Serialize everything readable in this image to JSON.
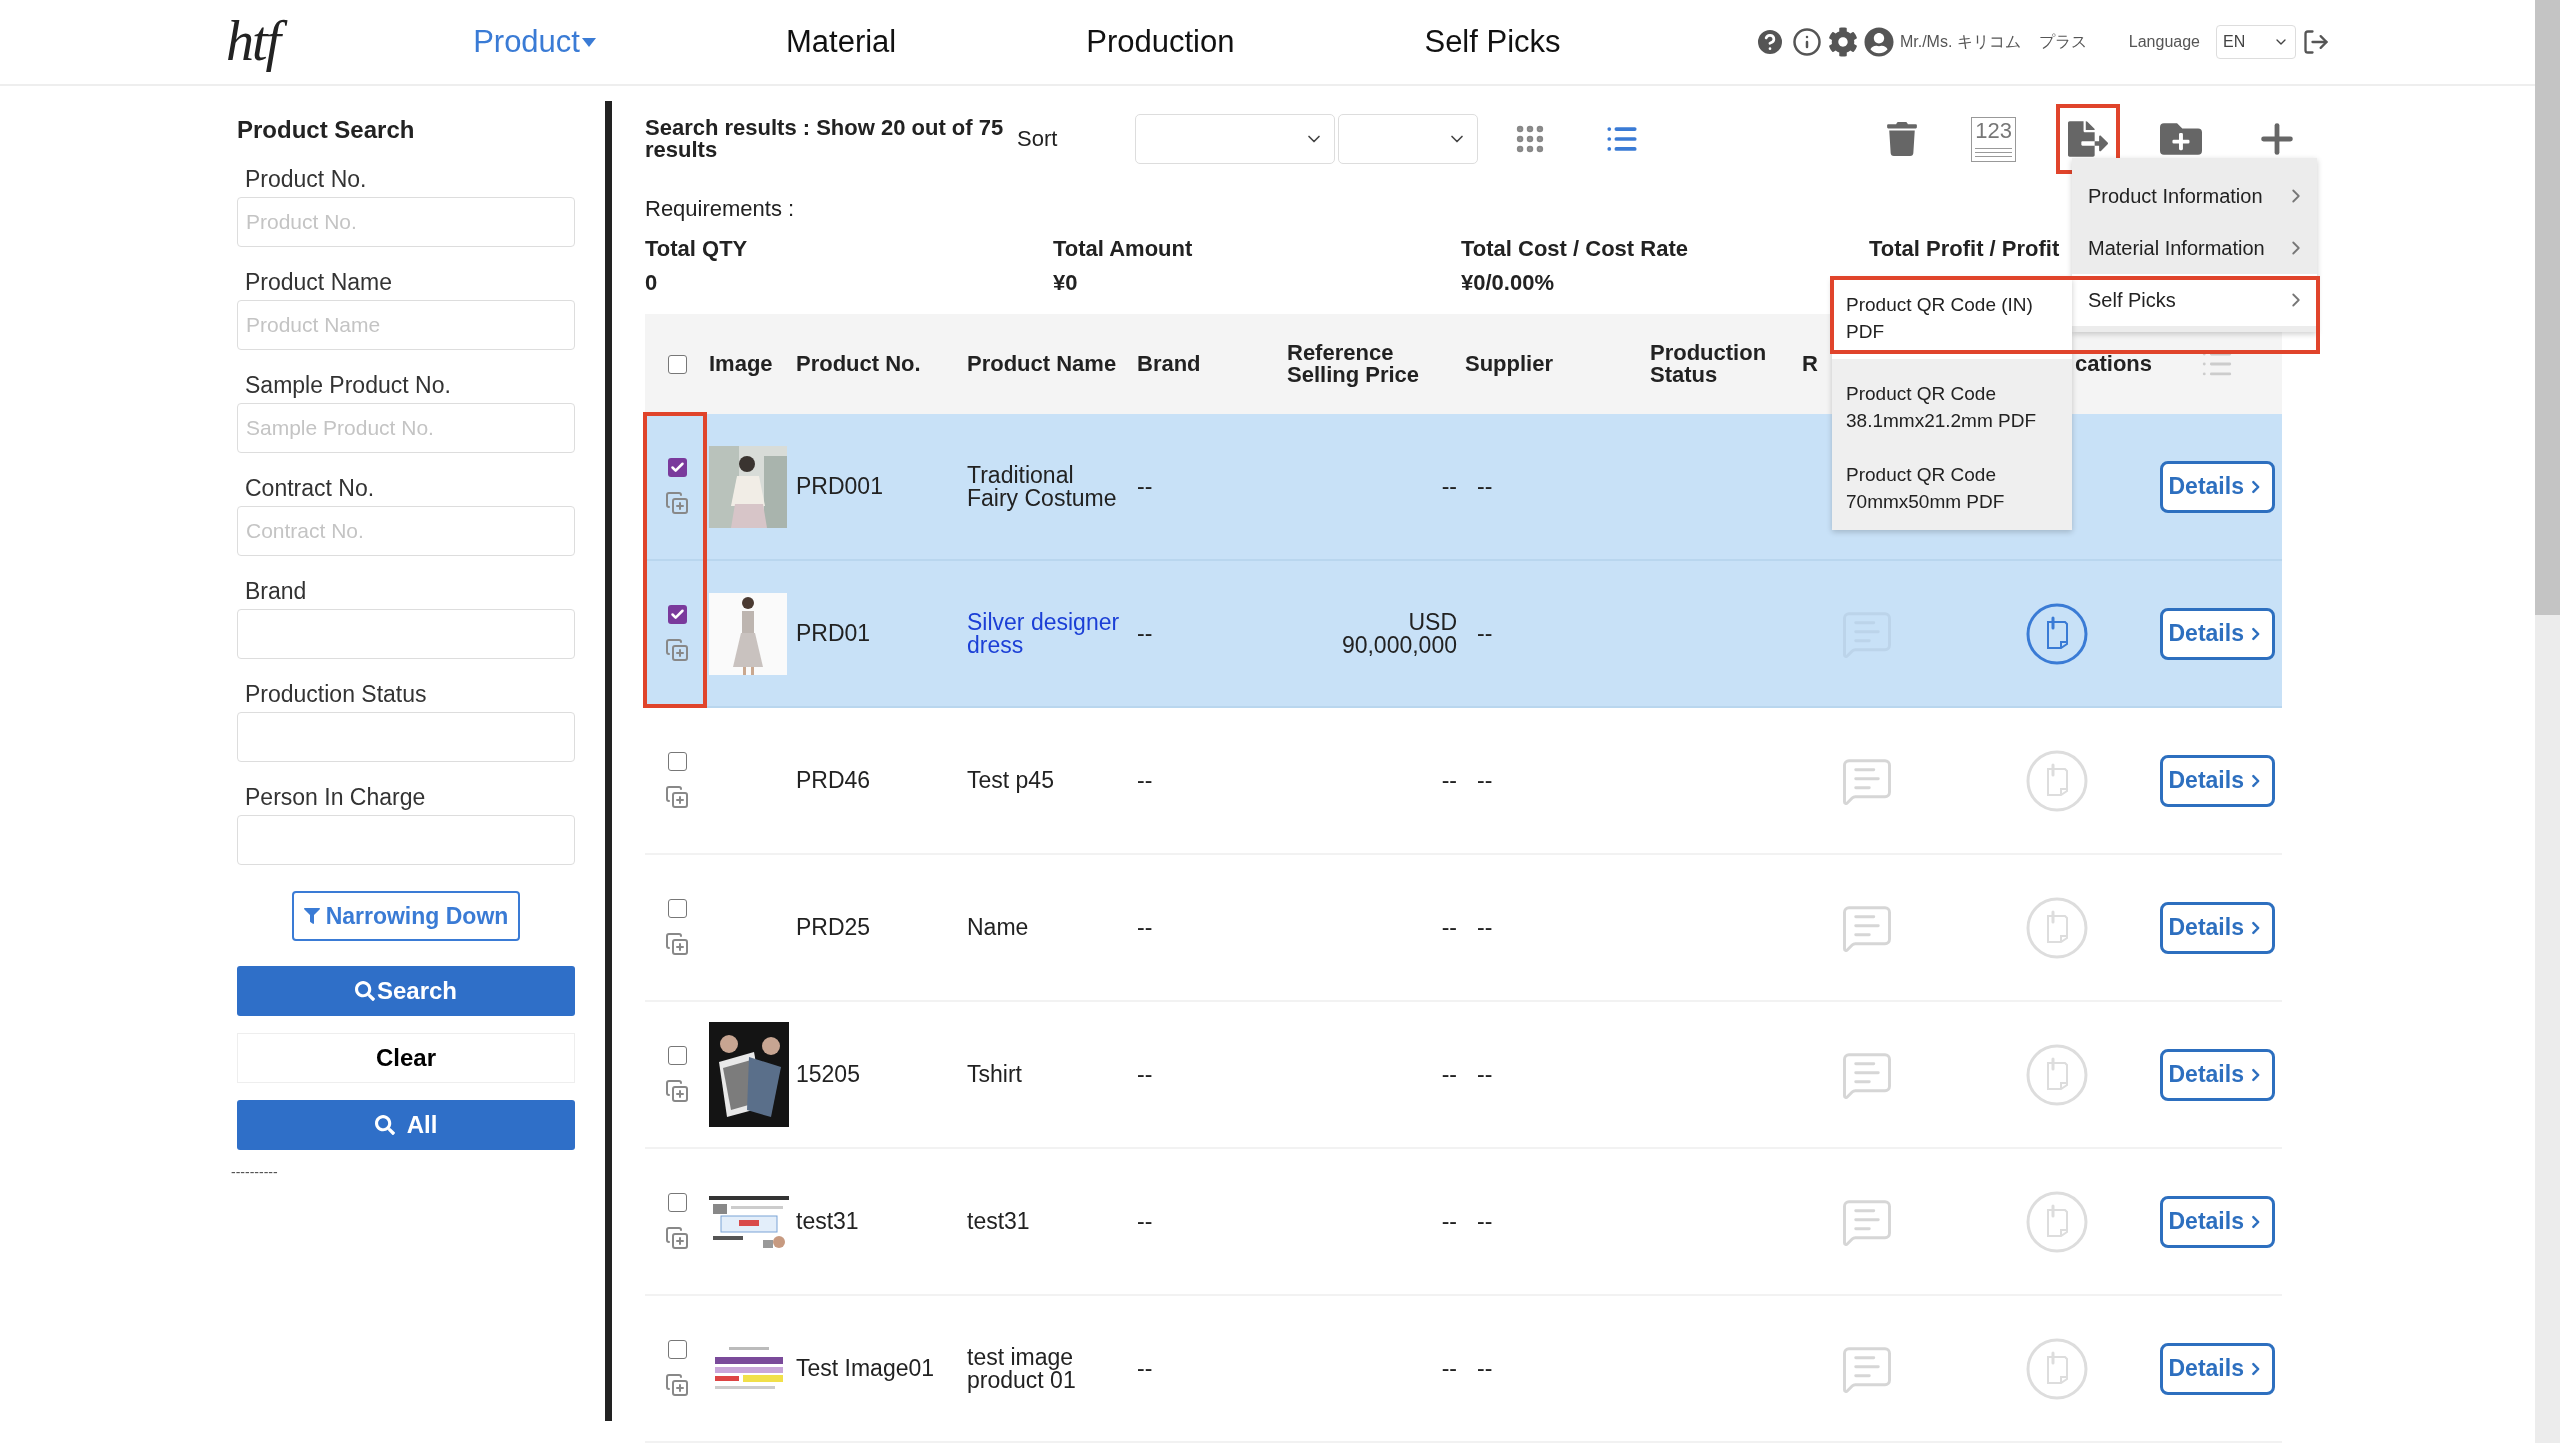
{
  "header": {
    "logo": "htf",
    "nav": [
      {
        "label": "Product",
        "selected": true
      },
      {
        "label": "Material",
        "selected": false
      },
      {
        "label": "Production",
        "selected": false
      },
      {
        "label": "Self Picks",
        "selected": false
      }
    ],
    "user": {
      "name": "Mr./Ms. キリコム",
      "plan": "プラス"
    },
    "language": {
      "label": "Language",
      "value": "EN"
    }
  },
  "sidebar": {
    "title": "Product Search",
    "fields": [
      {
        "label": "Product No.",
        "placeholder": "Product No."
      },
      {
        "label": "Product Name",
        "placeholder": "Product Name"
      },
      {
        "label": "Sample Product No.",
        "placeholder": "Sample Product No."
      },
      {
        "label": "Contract No.",
        "placeholder": "Contract No."
      },
      {
        "label": "Brand"
      },
      {
        "label": "Production Status"
      },
      {
        "label": "Person In Charge"
      }
    ],
    "narrow_button": "Narrowing Down",
    "search_button": "Search",
    "clear_button": "Clear",
    "all_button": "All",
    "footer": "----------"
  },
  "results": {
    "summary": "Search results : Show 20 out of 75 results",
    "sort_label": "Sort",
    "view_modes": [
      {
        "kind": "grid",
        "selected": false
      },
      {
        "kind": "list",
        "selected": true
      }
    ]
  },
  "toolbar": [
    {
      "kind": "trash",
      "highlighted": false
    },
    {
      "kind": "numbering",
      "label": "123",
      "highlighted": false
    },
    {
      "kind": "export",
      "highlighted": true
    },
    {
      "kind": "folder_add",
      "highlighted": false
    },
    {
      "kind": "add",
      "highlighted": false
    }
  ],
  "requirements": "Requirements :",
  "totals": [
    {
      "label": "Total QTY",
      "value": "0"
    },
    {
      "label": "Total Amount",
      "value": "¥0"
    },
    {
      "label": "Total Cost / Cost Rate",
      "value": "¥0/0.00%"
    },
    {
      "label": "Total Profit / Profit"
    }
  ],
  "table": {
    "all_checked": false,
    "check_column_highlighted": true,
    "columns": [
      "Image",
      "Product No.",
      "Product Name",
      "Brand",
      "Reference Selling Price",
      "Supplier",
      "Production Status",
      "R",
      "cations"
    ],
    "rows": [
      {
        "selected": true,
        "checked": true,
        "product_no": "PRD001",
        "name": "Traditional Fairy Costume",
        "link": false,
        "brand": "--",
        "price": "--",
        "supplier": "--",
        "details": "Details"
      },
      {
        "selected": true,
        "checked": true,
        "product_no": "PRD01",
        "name": "Silver designer dress",
        "link": true,
        "brand": "--",
        "price": "USD 90,000,000",
        "supplier": "--",
        "attached": true,
        "details": "Details"
      },
      {
        "selected": false,
        "checked": false,
        "product_no": "PRD46",
        "name": "Test p45",
        "link": false,
        "brand": "--",
        "price": "--",
        "supplier": "--",
        "attached": false,
        "details": "Details"
      },
      {
        "selected": false,
        "checked": false,
        "product_no": "PRD25",
        "name": "Name",
        "link": false,
        "brand": "--",
        "price": "--",
        "supplier": "--",
        "attached": false,
        "details": "Details"
      },
      {
        "selected": false,
        "checked": false,
        "product_no": "15205",
        "name": "Tshirt",
        "link": false,
        "brand": "--",
        "price": "--",
        "supplier": "--",
        "attached": false,
        "details": "Details"
      },
      {
        "selected": false,
        "checked": false,
        "product_no": "test31",
        "name": "test31",
        "link": false,
        "brand": "--",
        "price": "--",
        "supplier": "--",
        "attached": false,
        "details": "Details"
      },
      {
        "selected": false,
        "checked": false,
        "product_no": "Test Image01",
        "name": "test image product 01",
        "link": false,
        "brand": "--",
        "price": "--",
        "supplier": "--",
        "attached": false,
        "details": "Details"
      }
    ]
  },
  "export_menu": {
    "highlight": true,
    "items": [
      {
        "label": "Product Information",
        "selected": false
      },
      {
        "label": "Material Information",
        "selected": false
      },
      {
        "label": "Self Picks",
        "selected": true
      }
    ],
    "submenu": [
      {
        "label": "Product QR Code (IN) PDF",
        "selected": true
      },
      {
        "label": "Product QR Code 38.1mmx21.2mm PDF",
        "selected": false
      },
      {
        "label": "Product QR Code 70mmx50mm PDF",
        "selected": false
      }
    ]
  }
}
